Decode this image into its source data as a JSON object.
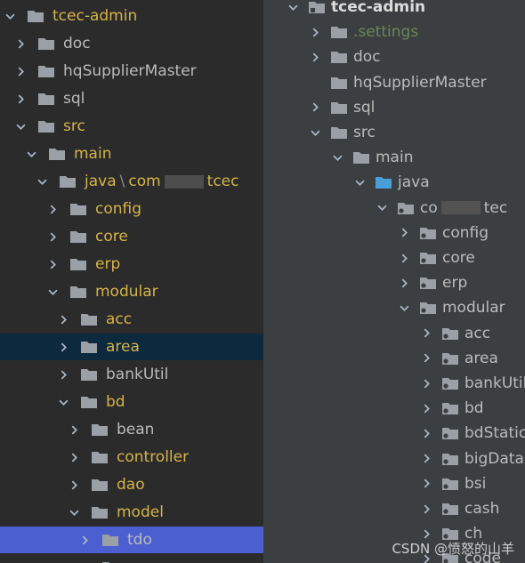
{
  "left_tree": [
    {
      "label": "tcec-admin",
      "depth": 0,
      "expanded": true,
      "color": "yellow"
    },
    {
      "label": "doc",
      "depth": 1,
      "expanded": false,
      "color": "normal"
    },
    {
      "label": "hqSupplierMaster",
      "depth": 1,
      "expanded": false,
      "color": "normal"
    },
    {
      "label": "sql",
      "depth": 1,
      "expanded": false,
      "color": "normal"
    },
    {
      "label": "src",
      "depth": 1,
      "expanded": true,
      "color": "yellow"
    },
    {
      "label": "main",
      "depth": 2,
      "expanded": true,
      "color": "yellow"
    },
    {
      "label": "java",
      "label2": "com",
      "label3": "tcec",
      "depth": 3,
      "expanded": true,
      "color": "yellow",
      "blurred": true
    },
    {
      "label": "config",
      "depth": 4,
      "expanded": false,
      "color": "yellow"
    },
    {
      "label": "core",
      "depth": 4,
      "expanded": false,
      "color": "yellow"
    },
    {
      "label": "erp",
      "depth": 4,
      "expanded": false,
      "color": "yellow"
    },
    {
      "label": "modular",
      "depth": 4,
      "expanded": true,
      "color": "yellow"
    },
    {
      "label": "acc",
      "depth": 5,
      "expanded": false,
      "color": "yellow"
    },
    {
      "label": "area",
      "depth": 5,
      "expanded": false,
      "color": "yellow",
      "state": "selected"
    },
    {
      "label": "bankUtil",
      "depth": 5,
      "expanded": false,
      "color": "normal"
    },
    {
      "label": "bd",
      "depth": 5,
      "expanded": true,
      "color": "yellow"
    },
    {
      "label": "bean",
      "depth": 6,
      "expanded": false,
      "color": "normal"
    },
    {
      "label": "controller",
      "depth": 6,
      "expanded": false,
      "color": "yellow"
    },
    {
      "label": "dao",
      "depth": 6,
      "expanded": false,
      "color": "yellow"
    },
    {
      "label": "model",
      "depth": 6,
      "expanded": true,
      "color": "yellow"
    },
    {
      "label": "tdo",
      "depth": 7,
      "expanded": false,
      "color": "normal",
      "state": "focused"
    },
    {
      "label": "",
      "depth": 7,
      "expanded": false,
      "color": "normal"
    }
  ],
  "right_tree": [
    {
      "label": "tcec-admin",
      "depth": 0,
      "expanded": true,
      "color": "bold",
      "icon": "module"
    },
    {
      "label": ".settings",
      "depth": 1,
      "expanded": false,
      "color": "green"
    },
    {
      "label": "doc",
      "depth": 1,
      "expanded": false,
      "color": "normal"
    },
    {
      "label": "hqSupplierMaster",
      "depth": 1,
      "expanded": null,
      "color": "normal"
    },
    {
      "label": "sql",
      "depth": 1,
      "expanded": false,
      "color": "normal"
    },
    {
      "label": "src",
      "depth": 1,
      "expanded": true,
      "color": "normal"
    },
    {
      "label": "main",
      "depth": 2,
      "expanded": true,
      "color": "normal"
    },
    {
      "label": "java",
      "depth": 3,
      "expanded": true,
      "color": "normal",
      "icon": "source"
    },
    {
      "label": "co",
      "label3": "tec",
      "depth": 4,
      "expanded": true,
      "color": "normal",
      "icon": "package",
      "blurred": true
    },
    {
      "label": "config",
      "depth": 5,
      "expanded": false,
      "color": "normal",
      "icon": "package"
    },
    {
      "label": "core",
      "depth": 5,
      "expanded": false,
      "color": "normal",
      "icon": "package"
    },
    {
      "label": "erp",
      "depth": 5,
      "expanded": false,
      "color": "normal",
      "icon": "package"
    },
    {
      "label": "modular",
      "depth": 5,
      "expanded": true,
      "color": "normal",
      "icon": "package"
    },
    {
      "label": "acc",
      "depth": 6,
      "expanded": false,
      "color": "normal",
      "icon": "package"
    },
    {
      "label": "area",
      "depth": 6,
      "expanded": false,
      "color": "normal",
      "icon": "package"
    },
    {
      "label": "bankUtil",
      "depth": 6,
      "expanded": false,
      "color": "normal",
      "icon": "package"
    },
    {
      "label": "bd",
      "depth": 6,
      "expanded": false,
      "color": "normal",
      "icon": "package"
    },
    {
      "label": "bdStatic",
      "depth": 6,
      "expanded": false,
      "color": "normal",
      "icon": "package"
    },
    {
      "label": "bigData",
      "depth": 6,
      "expanded": false,
      "color": "normal",
      "icon": "package"
    },
    {
      "label": "bsi",
      "depth": 6,
      "expanded": false,
      "color": "normal",
      "icon": "package"
    },
    {
      "label": "cash",
      "depth": 6,
      "expanded": false,
      "color": "normal",
      "icon": "package"
    },
    {
      "label": "ch",
      "depth": 6,
      "expanded": false,
      "color": "normal",
      "icon": "package"
    },
    {
      "label": "code",
      "depth": 6,
      "expanded": false,
      "color": "normal",
      "icon": "package"
    }
  ],
  "watermark": "CSDN @愤怒的山羊",
  "colors": {
    "yellow_text": "#d6b34a",
    "normal_text": "#bbbbbb",
    "green_text": "#6a8759",
    "folder_gray": "#9aa0a6",
    "source_folder_blue": "#4a9fd8",
    "selected_row": "#0d293e",
    "focused_row": "#4b5fd1"
  }
}
